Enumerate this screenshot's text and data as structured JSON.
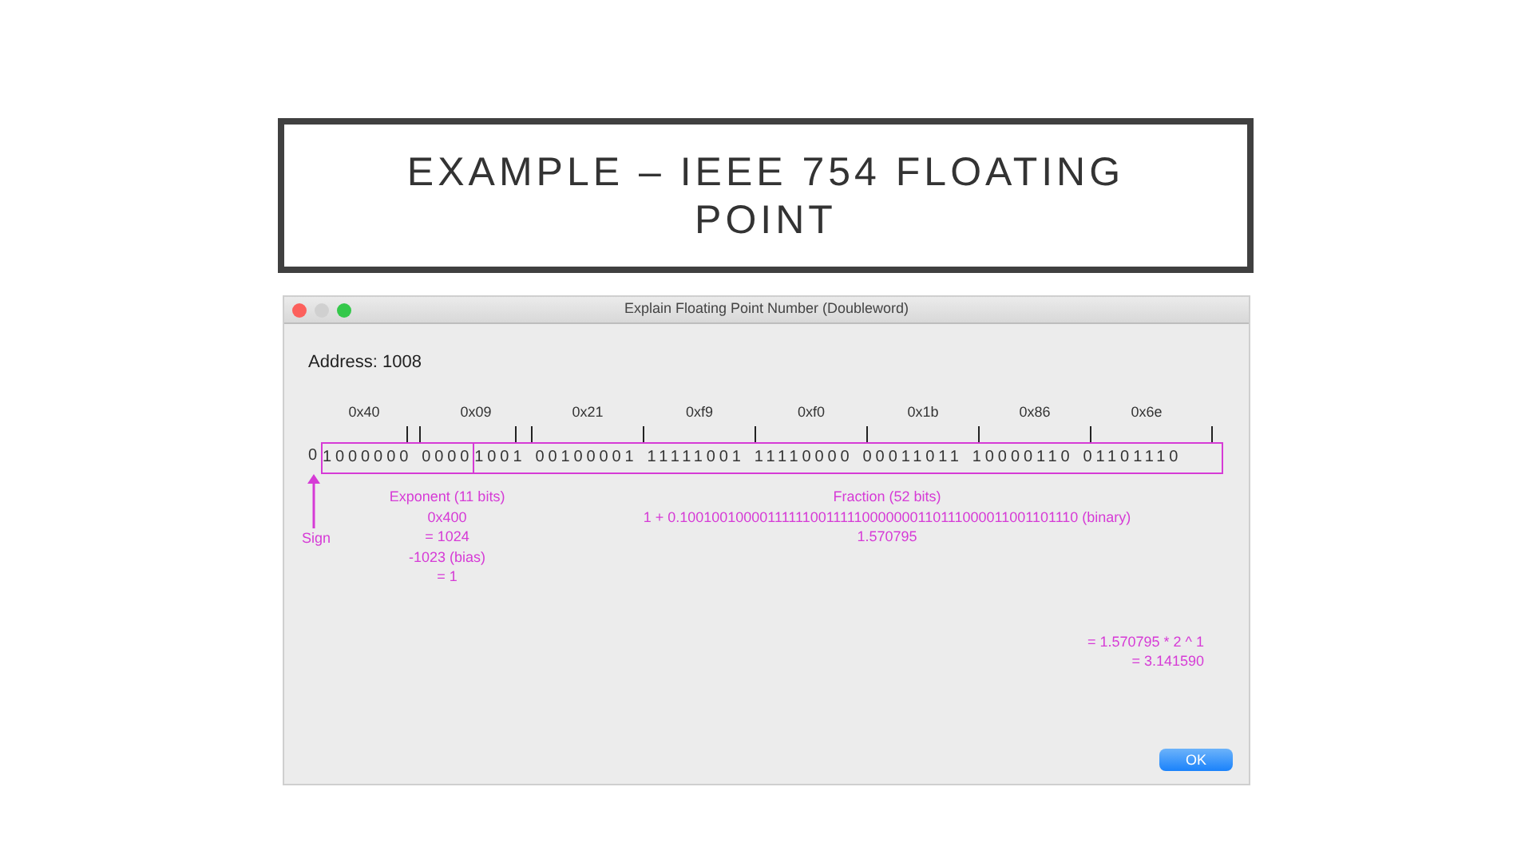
{
  "slide_title": "EXAMPLE – IEEE 754 FLOATING POINT",
  "window": {
    "title": "Explain Floating Point Number (Doubleword)"
  },
  "address": "Address: 1008",
  "bytes": [
    {
      "hex": "0x40"
    },
    {
      "hex": "0x09"
    },
    {
      "hex": "0x21"
    },
    {
      "hex": "0xf9"
    },
    {
      "hex": "0xf0"
    },
    {
      "hex": "0x1b"
    },
    {
      "hex": "0x86"
    },
    {
      "hex": "0x6e"
    }
  ],
  "bits": {
    "sign": "0",
    "exponent": [
      "1000000",
      "0000"
    ],
    "fraction": [
      "1001",
      "00100001",
      "11111001",
      "11110000",
      "00011011",
      "10000110",
      "01101110"
    ]
  },
  "sign_label": "Sign",
  "exponent_lines": [
    "Exponent (11 bits)",
    "0x400",
    "= 1024",
    "-1023 (bias)",
    "= 1"
  ],
  "fraction_lines": [
    "Fraction (52 bits)",
    "1 + 0.1001001000011111100111110000000110111000011001101110 (binary)",
    "1.570795"
  ],
  "result_lines": [
    "= 1.570795 * 2 ^ 1",
    "= 3.141590"
  ],
  "buttons": [
    "OK"
  ]
}
